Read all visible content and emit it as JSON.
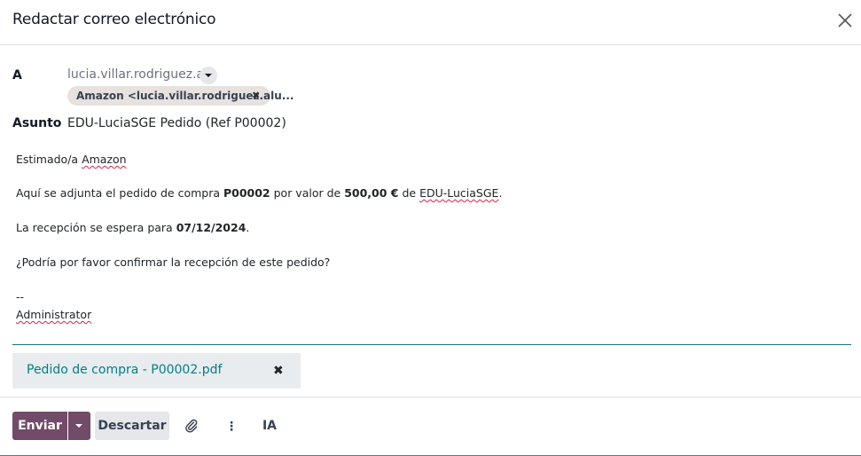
{
  "dialog": {
    "title": "Redactar correo electrónico",
    "close_icon": "close-icon"
  },
  "recipients": {
    "label": "A",
    "input_value": "lucia.villar.rodriguez.alu",
    "tags": [
      {
        "label": "Amazon <lucia.villar.rodriguez.alu...",
        "remove": "✖"
      }
    ]
  },
  "subject": {
    "label": "Asunto",
    "value": "EDU-LuciaSGE Pedido (Ref P00002)"
  },
  "body": {
    "greeting_prefix": "Estimado/a ",
    "greeting_name": "Amazon",
    "line1_a": "Aquí se adjunta el pedido de compra ",
    "order_ref": "P00002",
    "line1_b": " por valor de ",
    "amount": "500,00 €",
    "line1_c": " de ",
    "company": "EDU-LuciaSGE",
    "line1_d": ".",
    "line2_a": "La recepción se espera para ",
    "date": "07/12/2024",
    "line2_b": ".",
    "line3": "¿Podría por favor confirmar la recepción de este pedido?",
    "signature_sep": "--",
    "signature_name": "Administrator"
  },
  "attachment": {
    "name": "Pedido de compra - P00002.pdf",
    "remove": "✖"
  },
  "footer": {
    "send_label": "Enviar",
    "discard_label": "Descartar",
    "attach_icon": "paperclip-icon",
    "more_icon": "vertical-ellipsis-icon",
    "more_glyph": "⋮",
    "ai_label": "IA"
  },
  "colors": {
    "primary": "#714b67",
    "link": "#017e84",
    "editor_border": "#1d6f7a"
  }
}
